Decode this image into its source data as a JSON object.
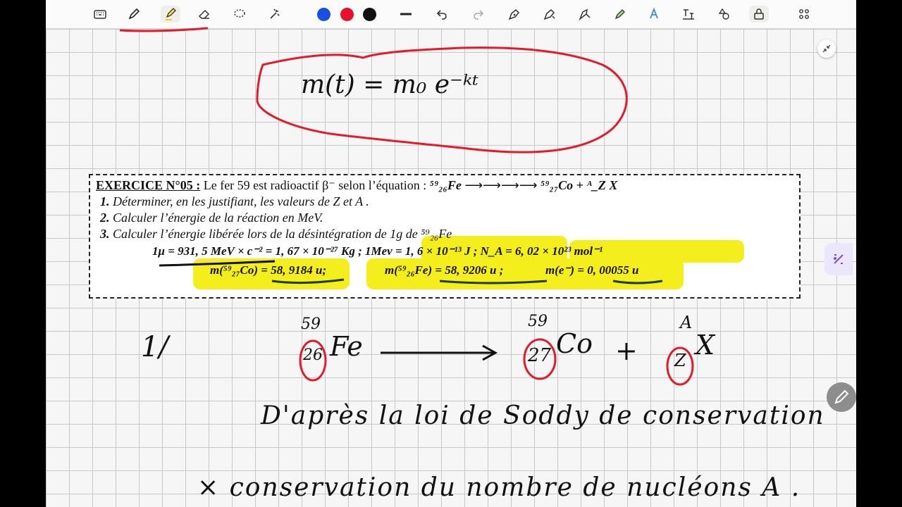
{
  "colors": {
    "red": "#e8102a",
    "blue": "#1a4fe0",
    "black": "#111111",
    "highlight": "#f4ef1c",
    "ink_red": "#e21b2b"
  },
  "toolbar": {
    "icons": [
      "keyboard-icon",
      "pen-icon",
      "highlighter-icon",
      "eraser-icon",
      "lasso-icon",
      "magic-icon",
      "color-blue",
      "color-red",
      "color-black",
      "stroke-width-icon",
      "undo-icon",
      "redo-icon",
      "shape-pen-icon",
      "shape-recognizer-icon",
      "pointer-icon",
      "highlighter-pen-icon",
      "text-icon",
      "text-box-icon",
      "shapes-icon",
      "lock-icon",
      "apps-icon"
    ]
  },
  "handwriting": {
    "formula": "m(t) = m₀ e⁻ᵏᵗ",
    "item_number": "1/",
    "reaction": {
      "fe_mass": "59",
      "fe_z": "26",
      "fe_symbol": "Fe",
      "co_mass": "59",
      "co_z": "27",
      "co_symbol": "Co",
      "plus": "+",
      "x_mass": "A",
      "x_z": "Z",
      "x_symbol": "X"
    },
    "sentence1": "D'après la loi de Soddy de conservation",
    "sentence2": "× conservation du nombre de nucléons A ."
  },
  "exercise": {
    "heading": "EXERCICE N°05 :",
    "intro": "Le fer 59 est radioactif β⁻ selon l’équation :",
    "equation_left": "⁵⁹₂₆Fe",
    "equation_right": "⁵⁹₂₇Co + ᴬ_Z X",
    "q1_num": "1.",
    "q1": "Déterminer, en les justifiant, les valeurs de Z et A .",
    "q2_num": "2.",
    "q2": "Calculer l’énergie de la réaction en MeV.",
    "q3_num": "3.",
    "q3": "Calculer l’énergie libérée lors de la désintégration de 1g de ⁵⁹₂₆Fe",
    "data_line1": "1μ = 931, 5 MeV × c⁻² = 1, 67 × 10⁻²⁷ Kg ;  1Mev = 1, 6 × 10⁻¹³ J  ;   N_A = 6, 02 × 10²³ mol⁻¹",
    "data_co": "m(⁵⁹₂₇Co) = 58, 9184 u;",
    "data_fe": "m(⁵⁹₂₆Fe) = 58, 9206 u ;",
    "data_e": "m(e⁻) = 0, 00055 u"
  }
}
